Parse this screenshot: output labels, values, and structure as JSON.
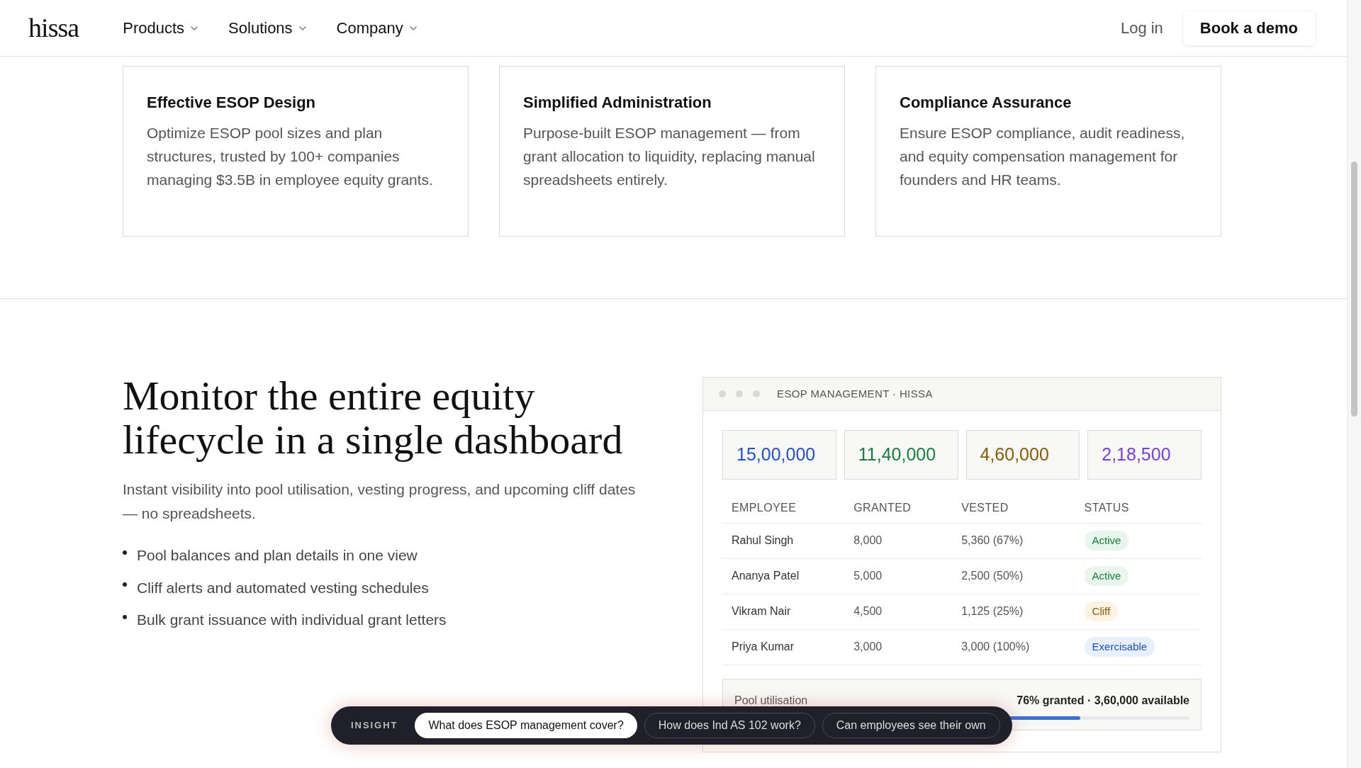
{
  "nav": {
    "logo": "hissa",
    "menus": [
      {
        "label": "Products"
      },
      {
        "label": "Solutions"
      },
      {
        "label": "Company"
      }
    ],
    "login": "Log in",
    "cta": "Book a demo"
  },
  "features": [
    {
      "title": "Effective ESOP Design",
      "text": "Optimize ESOP pool sizes and plan structures, trusted by 100+ companies managing $3.5B in employee equity grants."
    },
    {
      "title": "Simplified Administration",
      "text": "Purpose-built ESOP management — from grant allocation to liquidity, replacing manual spreadsheets entirely."
    },
    {
      "title": "Compliance Assurance",
      "text": "Ensure ESOP compliance, audit readiness, and equity compensation management for founders and HR teams."
    }
  ],
  "section": {
    "heading": "Monitor the entire equity lifecycle in a single dashboard",
    "lead": "Instant visibility into pool utilisation, vesting progress, and upcoming cliff dates — no spreadsheets.",
    "bullets": [
      "Pool balances and plan details in one view",
      "Cliff alerts and automated vesting schedules",
      "Bulk grant issuance with individual grant letters"
    ]
  },
  "dashboard": {
    "title": "ESOP MANAGEMENT · HISSA",
    "stats": [
      {
        "value": "15,00,000",
        "color": "#1d4ed8"
      },
      {
        "value": "11,40,000",
        "color": "#15803d"
      },
      {
        "value": "4,60,000",
        "color": "#8a5a00"
      },
      {
        "value": "2,18,500",
        "color": "#7c3aed"
      }
    ],
    "columns": [
      "EMPLOYEE",
      "GRANTED",
      "VESTED",
      "STATUS"
    ],
    "rows": [
      {
        "employee": "Rahul Singh",
        "granted": "8,000",
        "vested": "5,360 (67%)",
        "status": "Active",
        "kind": "active"
      },
      {
        "employee": "Ananya Patel",
        "granted": "5,000",
        "vested": "2,500 (50%)",
        "status": "Active",
        "kind": "active"
      },
      {
        "employee": "Vikram Nair",
        "granted": "4,500",
        "vested": "1,125 (25%)",
        "status": "Cliff",
        "kind": "cliff"
      },
      {
        "employee": "Priya Kumar",
        "granted": "3,000",
        "vested": "3,000 (100%)",
        "status": "Exercisable",
        "kind": "exercisable"
      }
    ],
    "pool": {
      "label": "Pool utilisation",
      "reading": "76% granted · 3,60,000 available",
      "level": 0.76
    }
  },
  "insight": {
    "label": "INSIGHT",
    "chips": [
      {
        "text": "What does ESOP management cover?",
        "selected": true
      },
      {
        "text": "How does Ind AS 102 work?",
        "selected": false
      },
      {
        "text": "Can employees see their own",
        "selected": false
      }
    ]
  }
}
